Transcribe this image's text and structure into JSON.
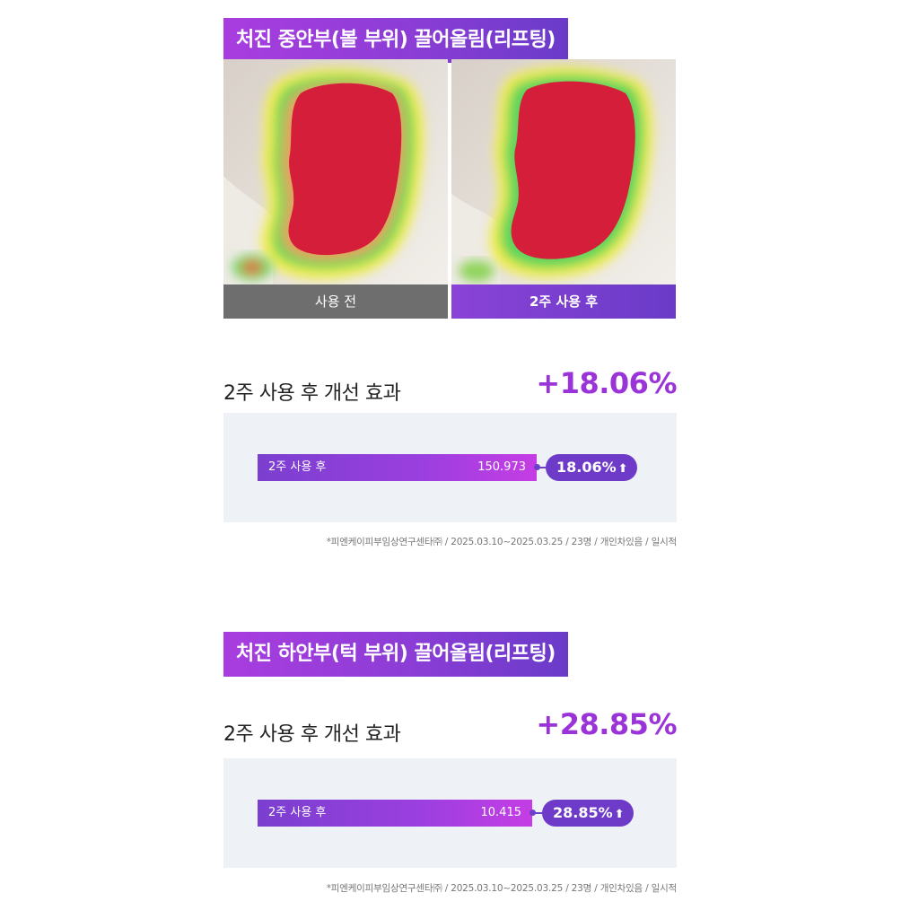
{
  "sections": [
    {
      "title": "처진 중안부(볼 부위) 끌어올림(리프팅)",
      "photo_before_caption": "사용 전",
      "photo_after_caption": "2주 사용 후",
      "result_label": "2주 사용 후 개선 효과",
      "result_value": "+18.06%",
      "bar_label": "2주 사용 후",
      "bar_value": "150.973",
      "bar_percent": "18.06%",
      "footnote": "*피엔케이피부임상연구센타㈜ / 2025.03.10~2025.03.25 / 23명 / 개인차있음 / 일시적"
    },
    {
      "title": "처진 하안부(턱 부위) 끌어올림(리프팅)",
      "result_label": "2주 사용 후 개선 효과",
      "result_value": "+28.85%",
      "bar_label": "2주 사용 후",
      "bar_value": "10.415",
      "bar_percent": "28.85%",
      "footnote": "*피엔케이피부임상연구센타㈜ / 2025.03.10~2025.03.25 / 23명 / 개인차있음 / 일시적"
    }
  ],
  "icons": {
    "up_arrow": "up-arrow-icon"
  },
  "colors": {
    "accent": "#9a34d8",
    "banner": "#8b3dd6",
    "panel": "#eef1f6",
    "caption_before": "#6e6e6e"
  }
}
